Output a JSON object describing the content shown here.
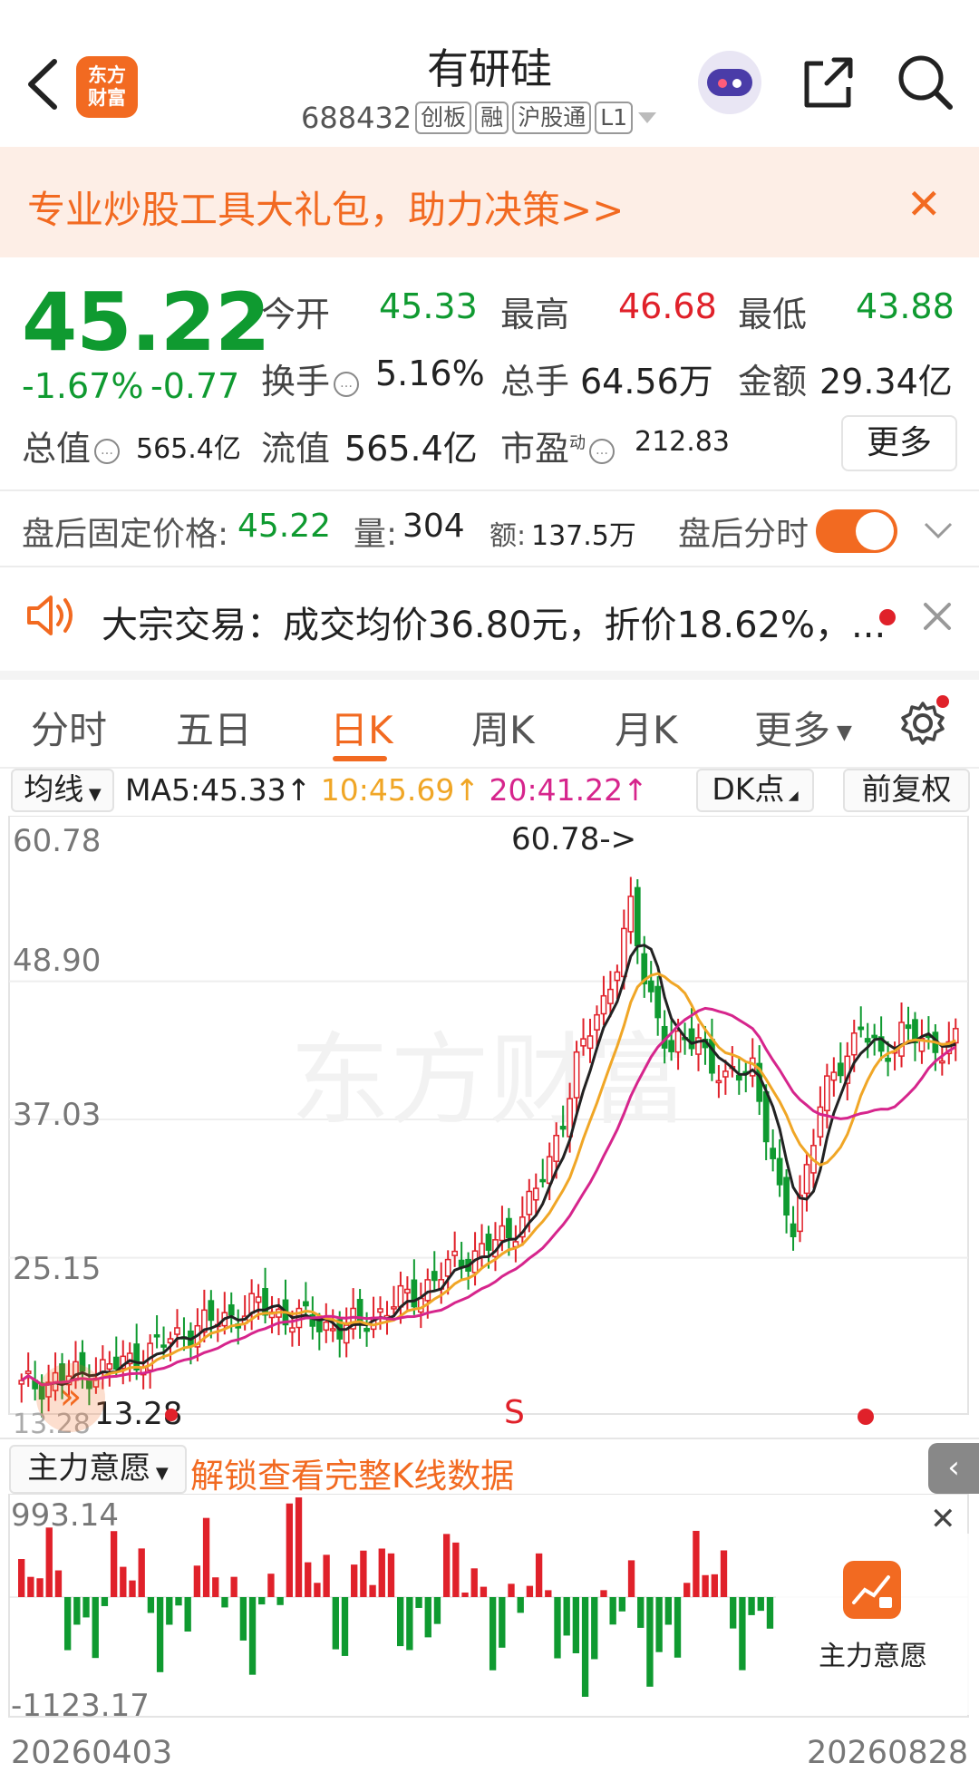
{
  "header": {
    "logo_line1": "东方",
    "logo_line2": "财富",
    "title": "有研硅",
    "code": "688432",
    "tags": [
      "创板",
      "融",
      "沪股通",
      "L1"
    ]
  },
  "banner": {
    "text": "专业炒股工具大礼包，助力决策>>",
    "close": "✕"
  },
  "quote": {
    "price": "45.22",
    "change_pct": "-1.67%",
    "change_amt": "-0.77",
    "open_label": "今开",
    "open": "45.33",
    "high_label": "最高",
    "high": "46.68",
    "low_label": "最低",
    "low": "43.88",
    "turnover_label": "换手",
    "turnover": "5.16%",
    "volume_label": "总手",
    "volume": "64.56万",
    "amount_label": "金额",
    "amount": "29.34亿",
    "mktcap_label": "总值",
    "mktcap": "565.4亿",
    "float_label": "流值",
    "float": "565.4亿",
    "pe_label": "市盈",
    "pe_sup": "动",
    "pe": "212.83",
    "more": "更多"
  },
  "after_hours": {
    "price_label": "盘后固定价格:",
    "price": "45.22",
    "vol_label": "量:",
    "vol": "304",
    "amt_label": "额:",
    "amt": "137.5万",
    "timeshare_label": "盘后分时"
  },
  "block_trade": {
    "text": "大宗交易：成交均价36.80元，折价18.62%，..."
  },
  "tabs": [
    "分时",
    "五日",
    "日K",
    "周K",
    "月K",
    "更多"
  ],
  "ma_row": {
    "avg_label": "均线",
    "ma5": "MA5:45.33",
    "ma10": "10:45.69",
    "ma20": "20:41.22",
    "dk": "DK点",
    "adjust": "前复权"
  },
  "chart_data": {
    "type": "candlestick",
    "ylim": [
      13.28,
      60.78
    ],
    "y_ticks": [
      "60.78",
      "48.90",
      "37.03",
      "25.15"
    ],
    "max_marker": "60.78->",
    "min_marker": "13.28",
    "low_axis_label": "13.28",
    "signal_s": "S",
    "ma_colors": {
      "ma5": "#222222",
      "ma10": "#f0a626",
      "ma20": "#d6258c"
    },
    "x_start": "20260403",
    "x_end": "20260828"
  },
  "indicator": {
    "label": "主力意愿",
    "unlock": "解锁查看完整K线数据",
    "max": "993.14",
    "min": "-1123.17",
    "card_label": "主力意愿",
    "close": "✕"
  },
  "colors": {
    "up": "#e0212a",
    "down": "#0f9a30",
    "accent": "#f26a21"
  }
}
